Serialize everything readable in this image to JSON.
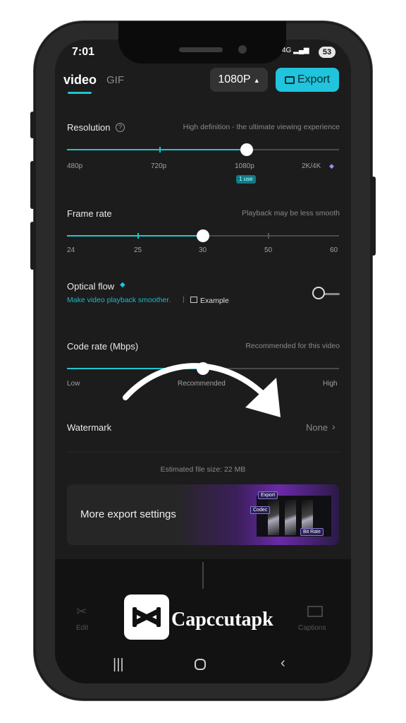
{
  "status_bar": {
    "time": "7:01",
    "network": "4G",
    "battery": "53"
  },
  "header": {
    "tabs": [
      {
        "label": "video",
        "active": true
      },
      {
        "label": "GIF",
        "active": false
      }
    ],
    "resolution_select": "1080P",
    "export_label": "Export"
  },
  "resolution": {
    "label": "Resolution",
    "hint": "High definition - the ultimate viewing experience",
    "ticks": [
      "480p",
      "720p",
      "1080p",
      "2K/4K"
    ],
    "badge": "1 use",
    "selected": "1080p"
  },
  "frame_rate": {
    "label": "Frame rate",
    "hint": "Playback may be less smooth",
    "ticks": [
      "24",
      "25",
      "30",
      "50",
      "60"
    ],
    "selected": "30"
  },
  "optical_flow": {
    "label": "Optical flow",
    "description": "Make video playback smoother.",
    "separator": "|",
    "example_label": "Example",
    "enabled": false
  },
  "code_rate": {
    "label": "Code rate (Mbps)",
    "hint": "Recommended for this video",
    "ticks": [
      "Low",
      "Recommended",
      "High"
    ],
    "selected": "Recommended"
  },
  "watermark": {
    "label": "Watermark",
    "value": "None"
  },
  "file_size": "Estimated file size: 22 MB",
  "banner": {
    "title": "More export settings",
    "tag_top": "Export",
    "tag_codec": "Codec",
    "tag_bitrate": "Bit Rate"
  },
  "bottom_nav": [
    {
      "label": "Edit"
    },
    {
      "label": "Captions"
    }
  ],
  "watermark_logo": "Capccutapk",
  "colors": {
    "accent": "#20c4cf",
    "background": "#1c1c1c"
  }
}
